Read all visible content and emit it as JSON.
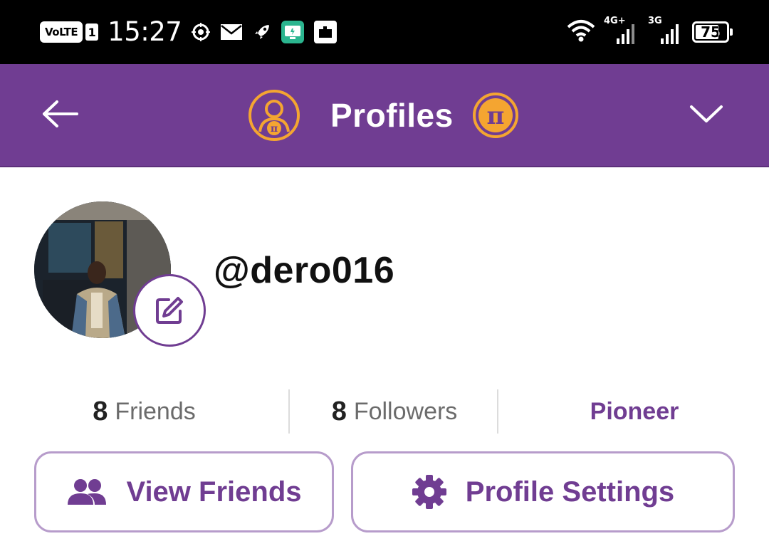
{
  "status_bar": {
    "volte_label": "VoLTE",
    "sim_slot": "1",
    "time": "15:27",
    "left_icons": [
      "location-target-icon",
      "mail-icon",
      "rocket-icon",
      "cast-app-icon",
      "app-notification-icon"
    ],
    "network_1": "4G+",
    "network_2": "3G",
    "battery_percent": "75",
    "battery_level": 0.75
  },
  "header": {
    "title": "Profiles",
    "background_color": "#703d92",
    "accent_color": "#f4a531"
  },
  "profile": {
    "username": "@dero016"
  },
  "stats": {
    "friends_count": "8",
    "friends_label": "Friends",
    "followers_count": "8",
    "followers_label": "Followers",
    "role": "Pioneer"
  },
  "actions": {
    "view_friends_label": "View Friends",
    "profile_settings_label": "Profile Settings"
  }
}
